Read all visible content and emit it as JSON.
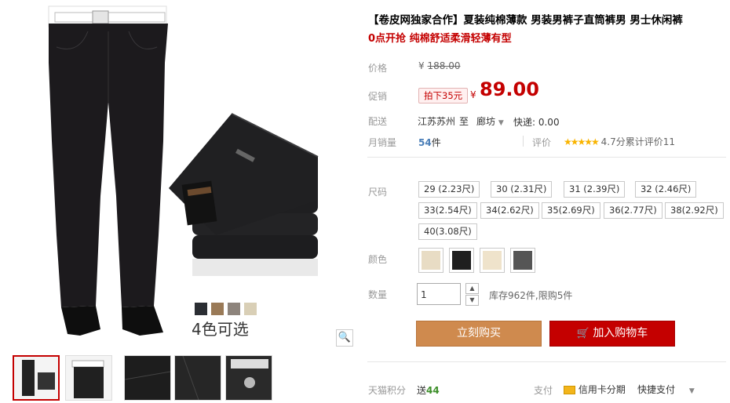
{
  "product": {
    "title": "【卷皮网独家合作】夏装纯棉薄款 男装男裤子直筒裤男 男士休闲裤",
    "subtitle": "0点开抢 纯棉舒适柔滑轻薄有型"
  },
  "price": {
    "label": "价格",
    "currency": "¥",
    "original": "188.00",
    "promo_label": "促销",
    "promo_tag": "拍下35元",
    "promo_price": "89.00"
  },
  "delivery": {
    "label": "配送",
    "from": "江苏苏州",
    "to_word": "至",
    "to": "廊坊",
    "shipping": "快递: 0.00"
  },
  "sales": {
    "label": "月销量",
    "count": "54",
    "unit": "件",
    "rating_label": "评价",
    "stars": "★★★★★",
    "rating_text": "4.7分累计评价11"
  },
  "size": {
    "label": "尺码",
    "options": [
      "29 (2.23尺)",
      "30 (2.31尺)",
      "31 (2.39尺)",
      "32 (2.46尺)",
      "33(2.54尺)",
      "34(2.62尺)",
      "35(2.69尺)",
      "36(2.77尺)",
      "38(2.92尺)",
      "40(3.08尺)"
    ]
  },
  "color": {
    "label": "颜色",
    "swatches": [
      "#e8dcc4",
      "#1f1f1f",
      "#efe3cb",
      "#555555"
    ]
  },
  "quantity": {
    "label": "数量",
    "value": "1",
    "stock": "库存962件,限购5件"
  },
  "buttons": {
    "buy": "立刻购买",
    "cart": "加入购物车",
    "cart_icon": "cart-icon"
  },
  "footer": {
    "points_label": "天猫积分",
    "points_prefix": "送",
    "points_value": "44",
    "pay_label": "支付",
    "pay_card": "信用卡分期",
    "pay_fast": "快捷支付"
  },
  "gallery": {
    "colors_text": "4色可选",
    "color_dots": [
      "#2b2e33",
      "#9a7a57",
      "#8d847c",
      "#d9cfb6"
    ],
    "zoom_icon": "magnifier-icon"
  }
}
